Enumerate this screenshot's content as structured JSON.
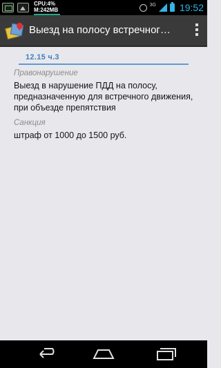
{
  "status_bar": {
    "cpu": "CPU:4%",
    "memory": "M:242MB",
    "network": "3G",
    "time": "19:52"
  },
  "action_bar": {
    "title": "Выезд на полосу встречног…"
  },
  "article": {
    "number": "12.15 ч.3",
    "violation_label": "Правонарушение",
    "violation_text": "Выезд в нарушение ПДД на полосу, предназначенную для встречного движения, при объезде препятствия",
    "sanction_label": "Санкция",
    "sanction_text": "штраф от 1000 до 1500 руб."
  },
  "icons": {
    "status_left": [
      "app-icon",
      "picture-icon"
    ],
    "status_right": [
      "alarm-icon",
      "signal-icon",
      "battery-icon"
    ],
    "nav": [
      "back-icon",
      "home-icon",
      "recent-apps-icon"
    ],
    "menu": "overflow-menu-icon"
  },
  "colors": {
    "accent": "#33b5e5",
    "article_number": "#3d7fc2",
    "field_underline": "#5b9ad6",
    "background": "#e8e8ec",
    "action_bar": "#3a3a3a"
  }
}
